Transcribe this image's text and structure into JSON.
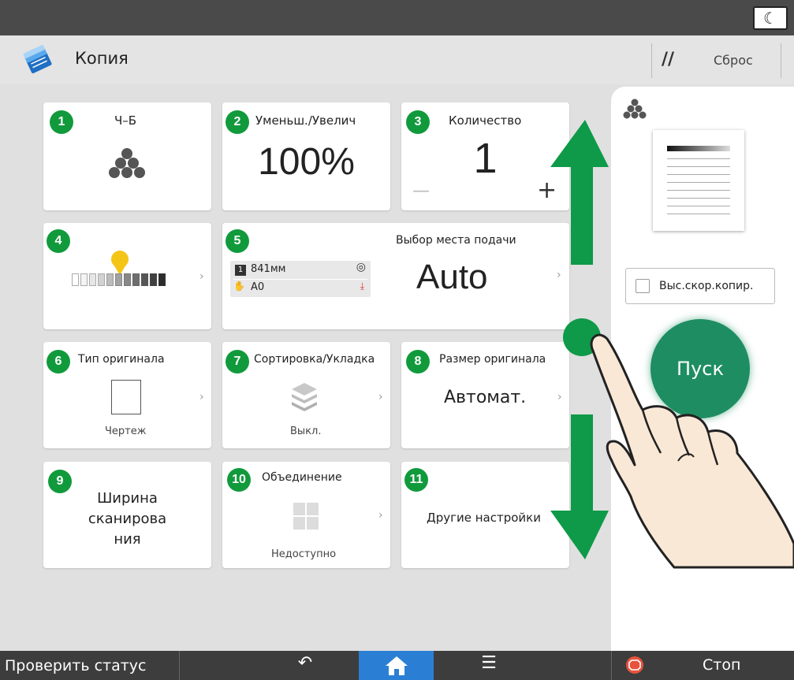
{
  "topbar": {
    "energy_icon": "moon-icon"
  },
  "header": {
    "title": "Копия",
    "reset_label": "Сброс",
    "reset_icon": "reset-icon"
  },
  "tiles": {
    "color": {
      "number": "1",
      "label": "Ч–Б"
    },
    "zoom": {
      "number": "2",
      "label": "Уменьш./Увелич",
      "value": "100%"
    },
    "quantity": {
      "number": "3",
      "label": "Количество",
      "value": "1",
      "minus": "—",
      "plus": "+"
    },
    "density": {
      "number": "4",
      "level": 0.5
    },
    "tray": {
      "number": "5",
      "label": "Выбор места подачи",
      "value": "Auto",
      "roll_label": "841мм",
      "roll_number": "1",
      "size_label": "A0"
    },
    "original_type": {
      "number": "6",
      "label": "Тип оригинала",
      "value": "Чертеж"
    },
    "sort": {
      "number": "7",
      "label": "Сортировка/Укладка",
      "value": "Выкл."
    },
    "original_size": {
      "number": "8",
      "label": "Размер оригинала",
      "value": "Автомат."
    },
    "scan_width": {
      "number": "9",
      "line1": "Ширина",
      "line2": "сканирова",
      "line3": "ния"
    },
    "combine": {
      "number": "10",
      "label": "Объединение",
      "value": "Недоступно"
    },
    "other": {
      "number": "11",
      "label": "Другие настройки"
    }
  },
  "sidebar": {
    "high_speed_label": "Выс.скор.копир.",
    "start_label": "Пуск"
  },
  "bottombar": {
    "status_label": "Проверить статус",
    "back_icon": "↶",
    "menu_icon": "☰",
    "stop_label": "Стоп"
  },
  "colors": {
    "badge": "#119a3c",
    "start": "#1e8e62",
    "arrow": "#0e9a48",
    "home": "#2a7fd4",
    "stop": "#e8523c"
  }
}
